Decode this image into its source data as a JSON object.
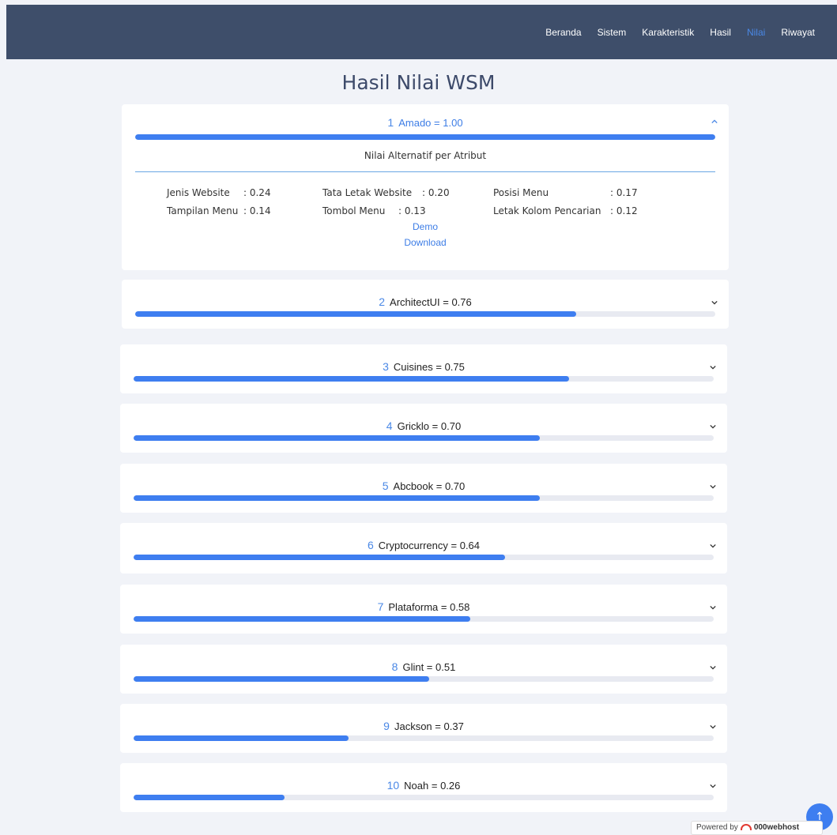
{
  "nav": [
    "Beranda",
    "Sistem",
    "Karakteristik",
    "Hasil",
    "Nilai",
    "Riwayat"
  ],
  "nav_active": "Nilai",
  "page_title": "Hasil Nilai WSM",
  "detail_title": "Nilai Alternatif per Atribut",
  "attributes": [
    {
      "label": "Jenis Website",
      "value": "0.24"
    },
    {
      "label": "Tata Letak Website",
      "value": "0.20"
    },
    {
      "label": "Posisi Menu",
      "value": "0.17"
    },
    {
      "label": "Tampilan Menu",
      "value": "0.14"
    },
    {
      "label": "Tombol Menu",
      "value": "0.13"
    },
    {
      "label": "Letak Kolom Pencarian",
      "value": "0.12"
    }
  ],
  "links": {
    "demo": "Demo",
    "download": "Download"
  },
  "results": [
    {
      "rank": "1",
      "name": "Amado",
      "score": "1.00",
      "fraction": 1.0
    },
    {
      "rank": "2",
      "name": "ArchitectUI",
      "score": "0.76",
      "fraction": 0.76
    },
    {
      "rank": "3",
      "name": "Cuisines",
      "score": "0.75",
      "fraction": 0.75
    },
    {
      "rank": "4",
      "name": "Gricklo",
      "score": "0.70",
      "fraction": 0.7
    },
    {
      "rank": "5",
      "name": "Abcbook",
      "score": "0.70",
      "fraction": 0.7
    },
    {
      "rank": "6",
      "name": "Cryptocurrency",
      "score": "0.64",
      "fraction": 0.64
    },
    {
      "rank": "7",
      "name": "Plataforma",
      "score": "0.58",
      "fraction": 0.58
    },
    {
      "rank": "8",
      "name": "Glint",
      "score": "0.51",
      "fraction": 0.51
    },
    {
      "rank": "9",
      "name": "Jackson",
      "score": "0.37",
      "fraction": 0.37
    },
    {
      "rank": "10",
      "name": "Noah",
      "score": "0.26",
      "fraction": 0.26
    }
  ],
  "powered": {
    "prefix": "Powered by",
    "brand": "000webhost"
  },
  "colors": {
    "navbar": "#3e4e6a",
    "accent": "#3e7ef0",
    "background": "#f1f3f8"
  }
}
